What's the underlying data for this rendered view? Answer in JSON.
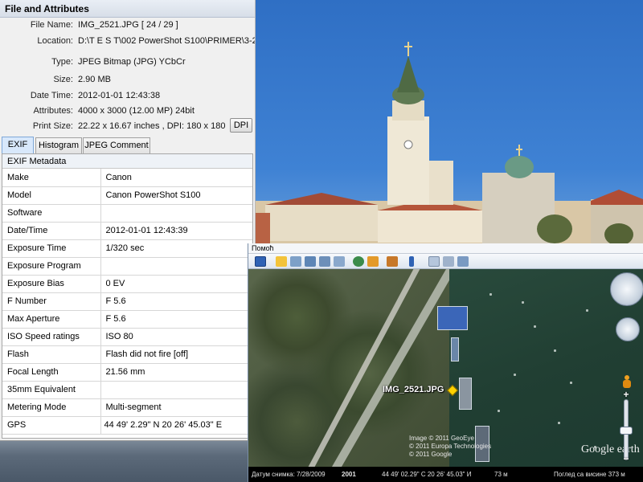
{
  "panel": {
    "title": "File and Attributes",
    "fields": [
      {
        "label": "File Name:",
        "value": "IMG_2521.JPG   [ 24 / 29 ]"
      },
      {
        "label": "Location:",
        "value": "D:\\T E S T\\002 PowerShot S100\\PRIMER\\3-2\\"
      },
      {
        "label": "Type:",
        "value": "JPEG Bitmap (JPG) YCbCr"
      },
      {
        "label": "Size:",
        "value": "2.90 MB"
      },
      {
        "label": "Date Time:",
        "value": "2012-01-01 12:43:38"
      },
      {
        "label": "Attributes:",
        "value": "4000 x 3000 (12.00 MP)  24bit"
      },
      {
        "label": "Print Size:",
        "value": "22.22 x 16.67 inches ,   DPI: 180 x 180"
      }
    ],
    "dpi_button": "DPI",
    "tabs": [
      "EXIF",
      "Histogram",
      "JPEG Comment"
    ],
    "active_tab": "EXIF"
  },
  "exif": {
    "title": "EXIF Metadata",
    "rows": [
      {
        "key": "Make",
        "value": "Canon"
      },
      {
        "key": "Model",
        "value": "Canon PowerShot S100"
      },
      {
        "key": "Software",
        "value": ""
      },
      {
        "key": "Date/Time",
        "value": "2012-01-01 12:43:39"
      },
      {
        "key": "Exposure Time",
        "value": "1/320 sec"
      },
      {
        "key": "Exposure Program",
        "value": ""
      },
      {
        "key": "Exposure Bias",
        "value": "0 EV"
      },
      {
        "key": "F Number",
        "value": "F 5.6"
      },
      {
        "key": "Max Aperture",
        "value": "F 5.6"
      },
      {
        "key": "ISO Speed ratings",
        "value": "ISO 80"
      },
      {
        "key": "Flash",
        "value": "Flash did not fire [off]"
      },
      {
        "key": "Focal Length",
        "value": "21.56 mm"
      },
      {
        "key": "35mm Equivalent",
        "value": ""
      },
      {
        "key": "Metering Mode",
        "value": "Multi-segment"
      },
      {
        "key": "GPS",
        "value": "44 49' 2.29\" N    20 26' 45.03\" E"
      }
    ]
  },
  "earth": {
    "menu": "Помоћ",
    "pin_label": "IMG_2521.JPG",
    "credits": [
      "Image © 2011 GeoEye",
      "© 2011 Europa Technologies",
      "© 2011 Google"
    ],
    "logo": "Google earth",
    "status": {
      "imagery_date": "Датум снимка: 7/28/2009",
      "year": "2001",
      "coords": "44 49' 02.29\" С   20 26' 45.03\" И",
      "elevation": "73 м",
      "eye_alt": "Поглед са висине   373 м"
    },
    "zoom_plus": "+",
    "zoom_minus": "−"
  },
  "colors": {
    "active_tab": "#d8e8fb",
    "panel_bg": "#f0f0f0",
    "status_bg": "#000000"
  }
}
